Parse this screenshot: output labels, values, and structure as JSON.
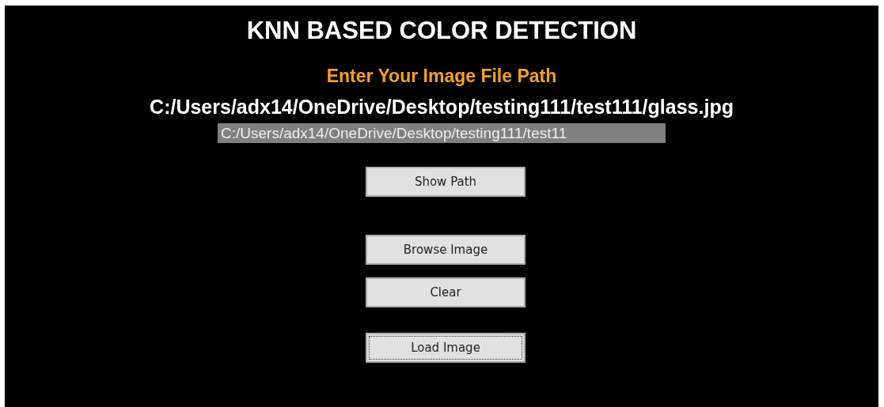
{
  "title": "KNN BASED COLOR DETECTION",
  "prompt": "Enter Your Image File Path",
  "path_display": "C:/Users/adx14/OneDrive/Desktop/testing111/test111/glass.jpg",
  "path_field": {
    "value": "C:/Users/adx14/OneDrive/Desktop/testing111/test11",
    "selected": true
  },
  "buttons": [
    {
      "label": "Show Path",
      "focused": false
    },
    {
      "label": "Browse Image",
      "focused": false
    },
    {
      "label": "Clear",
      "focused": false
    },
    {
      "label": "Load Image",
      "focused": true
    }
  ]
}
